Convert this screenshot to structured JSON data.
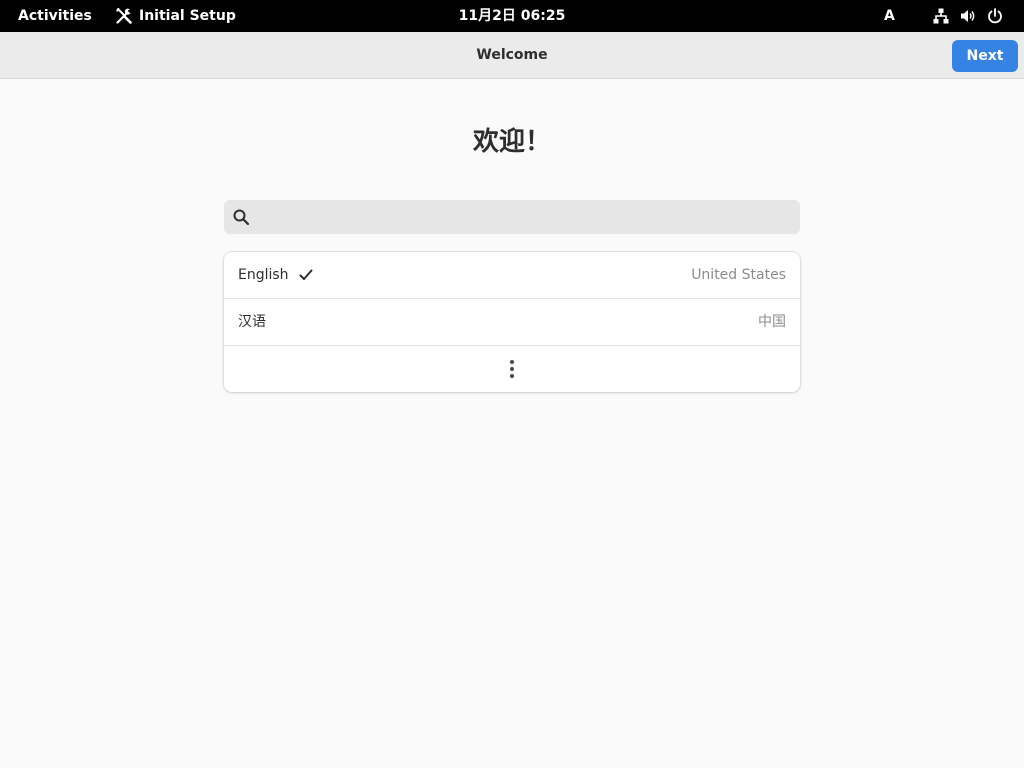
{
  "topbar": {
    "activities_label": "Activities",
    "app_name": "Initial Setup",
    "app_icon": "wrench-screwdriver-icon",
    "clock": "11月2日  06:25",
    "input_source": "A",
    "status_icons": [
      "network-icon",
      "volume-icon",
      "power-icon"
    ]
  },
  "header": {
    "title": "Welcome",
    "next_label": "Next"
  },
  "main": {
    "welcome_title": "欢迎！",
    "search": {
      "value": "",
      "placeholder": ""
    },
    "languages": [
      {
        "name": "English",
        "region": "United States",
        "selected": true
      },
      {
        "name": "汉语",
        "region": "中国",
        "selected": false
      }
    ],
    "more_icon": "more-vertical-icon"
  },
  "colors": {
    "topbar_bg": "#000000",
    "header_bg": "#ebebeb",
    "accent": "#3584e4",
    "page_bg": "#fafafa"
  }
}
